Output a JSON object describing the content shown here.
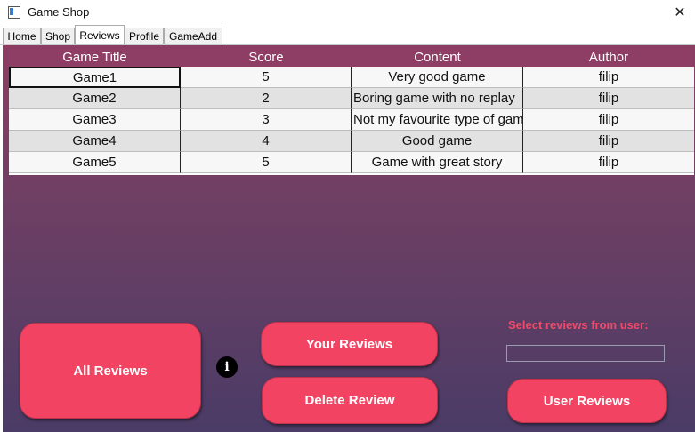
{
  "window": {
    "title": "Game Shop",
    "close_glyph": "✕"
  },
  "tabs": [
    {
      "label": "Home"
    },
    {
      "label": "Shop"
    },
    {
      "label": "Reviews",
      "active": true
    },
    {
      "label": "Profile"
    },
    {
      "label": "GameAdd"
    }
  ],
  "grid": {
    "columns": [
      "Game Title",
      "Score",
      "Content",
      "Author"
    ],
    "rows": [
      [
        "Game1",
        "5",
        "Very good game",
        "filip"
      ],
      [
        "Game2",
        "2",
        "Boring game with no replay",
        "filip"
      ],
      [
        "Game3",
        "3",
        "Not my favourite type of game",
        "filip"
      ],
      [
        "Game4",
        "4",
        "Good game",
        "filip"
      ],
      [
        "Game5",
        "5",
        "Game with great story",
        "filip"
      ]
    ]
  },
  "buttons": {
    "all_reviews": "All Reviews",
    "your_reviews": "Your Reviews",
    "delete_review": "Delete Review",
    "user_reviews": "User Reviews"
  },
  "info_icon": "i",
  "select_label": "Select reviews from user:",
  "user_input": {
    "value": "",
    "placeholder": ""
  },
  "colors": {
    "accent": "#f24462",
    "header": "#8e3d64"
  }
}
